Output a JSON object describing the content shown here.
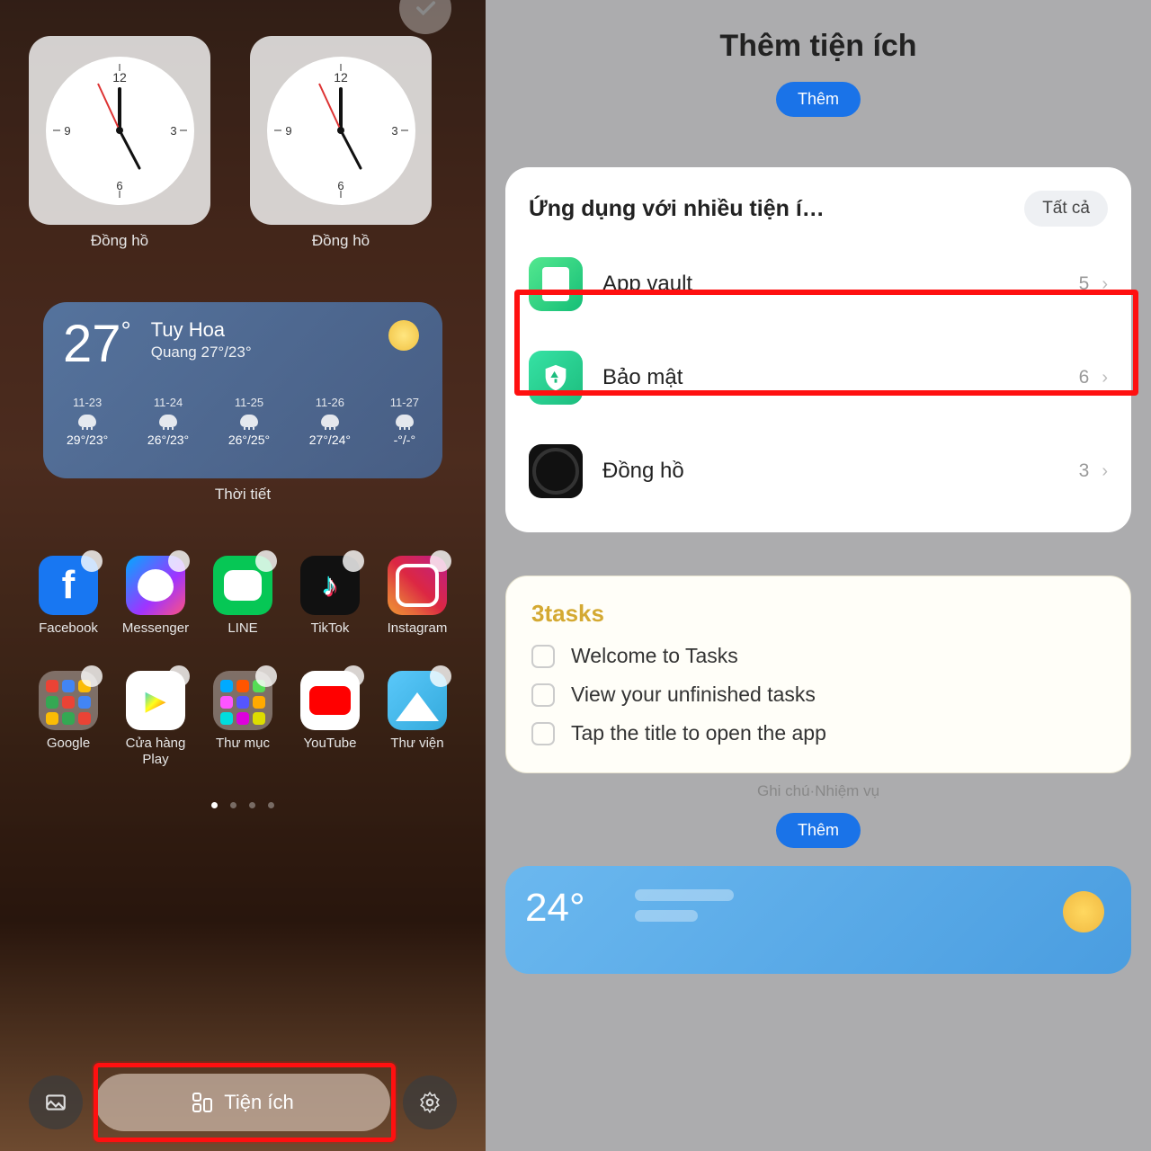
{
  "left": {
    "clock_label": "Đồng hồ",
    "weather": {
      "temp": "27",
      "city": "Tuy Hoa",
      "subline": "Quang  27°/23°",
      "label": "Thời tiết",
      "forecast": [
        {
          "date": "11-23",
          "temps": "29°/23°"
        },
        {
          "date": "11-24",
          "temps": "26°/23°"
        },
        {
          "date": "11-25",
          "temps": "26°/25°"
        },
        {
          "date": "11-26",
          "temps": "27°/24°"
        },
        {
          "date": "11-27",
          "temps": "-°/-°"
        }
      ]
    },
    "apps": {
      "fb": "Facebook",
      "msg": "Messenger",
      "line": "LINE",
      "tt": "TikTok",
      "ig": "Instagram",
      "google": "Google",
      "play": "Cửa hàng Play",
      "folder": "Thư mục",
      "yt": "YouTube",
      "gallery": "Thư viện"
    },
    "widgets_btn": "Tiện ích"
  },
  "right": {
    "title": "Thêm tiện ích",
    "add_btn": "Thêm",
    "section_title": "Ứng dụng với nhiều tiện í…",
    "all_btn": "Tất cả",
    "items": [
      {
        "label": "App vault",
        "count": "5"
      },
      {
        "label": "Bảo mật",
        "count": "6"
      },
      {
        "label": "Đồng hồ",
        "count": "3"
      }
    ],
    "tasks": {
      "title": "3tasks",
      "rows": [
        "Welcome to Tasks",
        "View your unfinished tasks",
        "Tap the title to open the app"
      ],
      "footer": "Ghi chú·Nhiệm vụ"
    },
    "weather_temp": "24"
  }
}
